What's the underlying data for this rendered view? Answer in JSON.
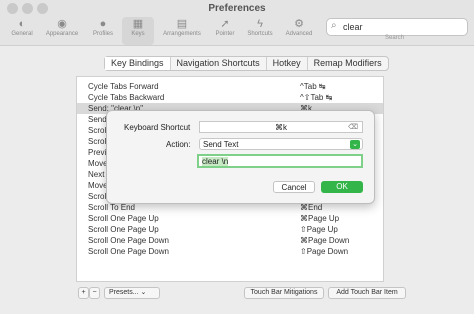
{
  "window": {
    "title": "Preferences"
  },
  "toolbar": {
    "items": [
      {
        "label": "General",
        "icon": "toggle-icon"
      },
      {
        "label": "Appearance",
        "icon": "eye-icon"
      },
      {
        "label": "Profiles",
        "icon": "user-icon"
      },
      {
        "label": "Keys",
        "icon": "keyboard-icon"
      },
      {
        "label": "Arrangements",
        "icon": "grid-icon"
      },
      {
        "label": "Pointer",
        "icon": "pointer-icon"
      },
      {
        "label": "Shortcuts",
        "icon": "bolt-icon"
      },
      {
        "label": "Advanced",
        "icon": "gears-icon"
      }
    ],
    "selected": "Keys"
  },
  "search": {
    "value": "clear",
    "label": "Search"
  },
  "tabs": [
    "Key Bindings",
    "Navigation Shortcuts",
    "Hotkey",
    "Remap Modifiers"
  ],
  "bindings": [
    {
      "action": "Cycle Tabs Forward",
      "key": "^Tab ↹"
    },
    {
      "action": "Cycle Tabs Backward",
      "key": "^⇧Tab ↹"
    },
    {
      "action": "Send: \"clear \\n\"",
      "key": "⌘k"
    },
    {
      "action": "Send",
      "key": ""
    },
    {
      "action": "Scrol",
      "key": ""
    },
    {
      "action": "Scrol",
      "key": ""
    },
    {
      "action": "Previ",
      "key": ""
    },
    {
      "action": "Move",
      "key": ""
    },
    {
      "action": "Next",
      "key": ""
    },
    {
      "action": "Move",
      "key": ""
    },
    {
      "action": "Scroll",
      "key": ""
    },
    {
      "action": "Scroll To End",
      "key": "⌘End"
    },
    {
      "action": "Scroll One Page Up",
      "key": "⌘Page Up"
    },
    {
      "action": "Scroll One Page Up",
      "key": "⇧Page Up"
    },
    {
      "action": "Scroll One Page Down",
      "key": "⌘Page Down"
    },
    {
      "action": "Scroll One Page Down",
      "key": "⇧Page Down"
    }
  ],
  "footer": {
    "add": "+",
    "remove": "−",
    "presets": "Presets...",
    "touch_bar_mitigations": "Touch Bar Mitigations",
    "add_touch_bar_item": "Add Touch Bar Item"
  },
  "dialog": {
    "shortcut_label": "Keyboard Shortcut",
    "shortcut_value": "⌘k",
    "action_label": "Action:",
    "action_value": "Send Text",
    "text_value": "clear \\n",
    "cancel": "Cancel",
    "ok": "OK"
  },
  "colors": {
    "accent": "#33b54a",
    "selection": "#d9d9d9"
  }
}
